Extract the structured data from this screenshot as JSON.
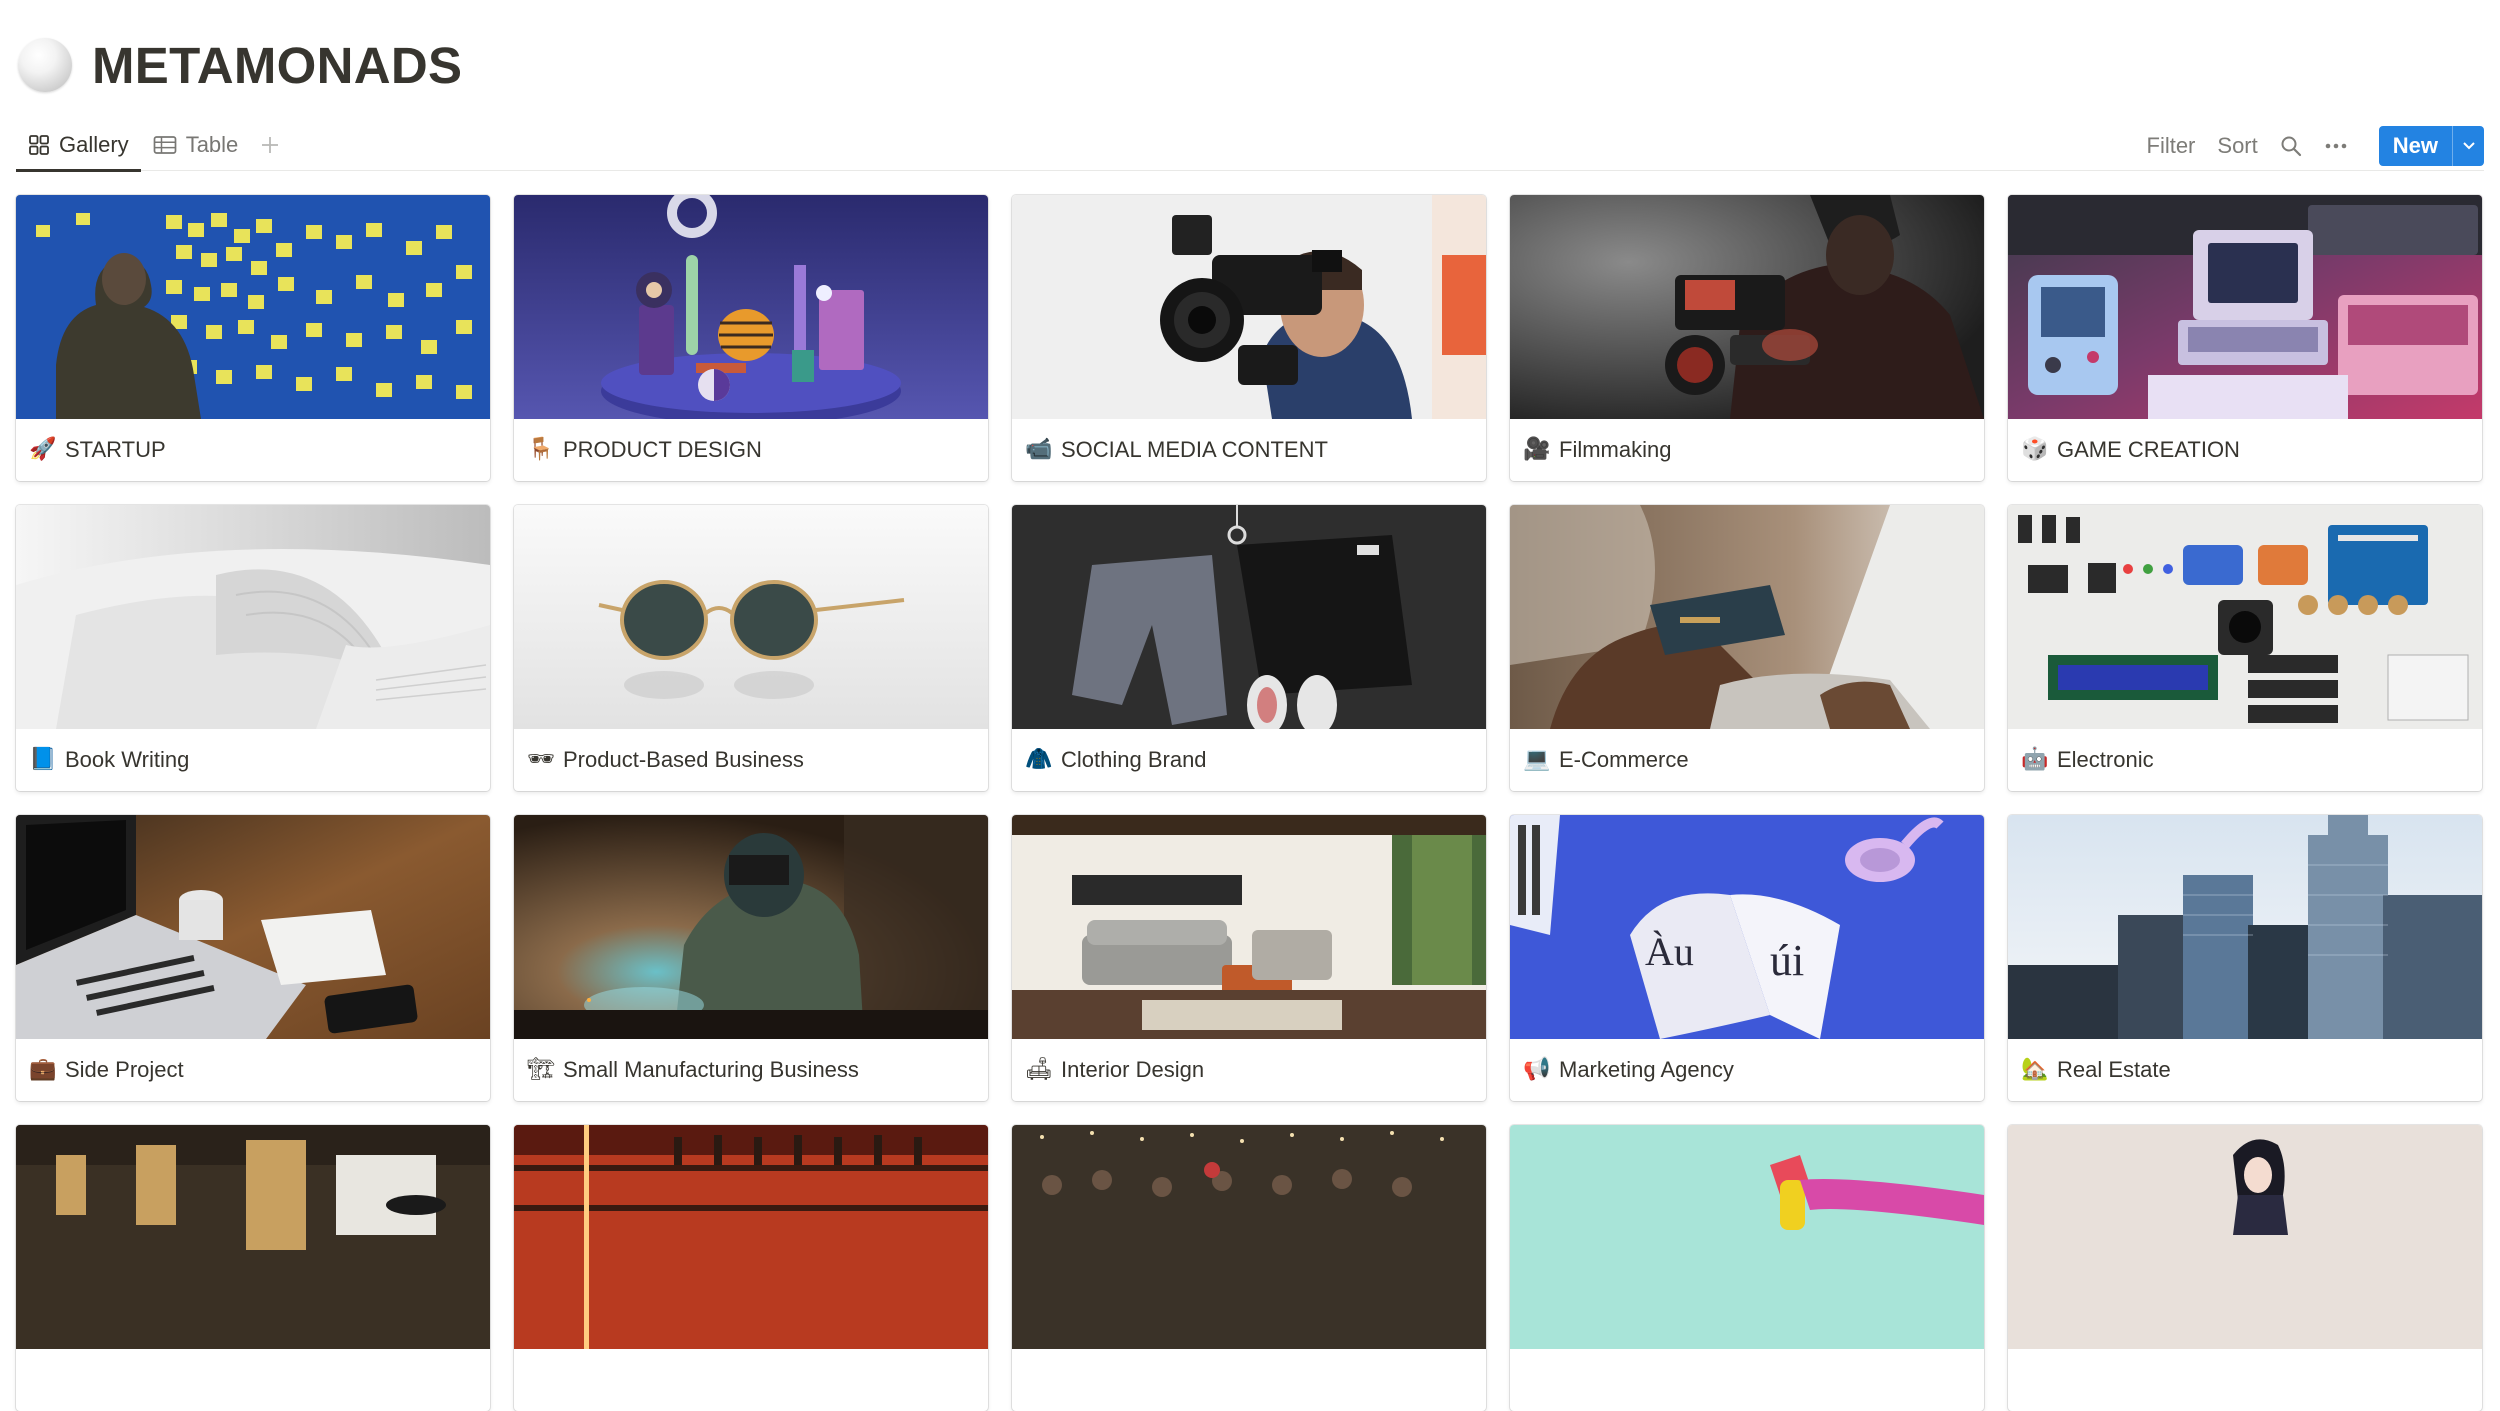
{
  "page": {
    "title": "METAMONADS"
  },
  "views": [
    {
      "label": "Gallery",
      "active": true
    },
    {
      "label": "Table",
      "active": false
    }
  ],
  "toolbar": {
    "filter": "Filter",
    "sort": "Sort",
    "new_label": "New"
  },
  "cards": [
    {
      "icon": "rocket-icon",
      "glyph": "🚀",
      "title": "STARTUP",
      "cover": "sticky-notes-wall"
    },
    {
      "icon": "chair-icon",
      "glyph": "🪑",
      "title": "PRODUCT DESIGN",
      "cover": "3d-objects"
    },
    {
      "icon": "video-camera-icon",
      "glyph": "📹",
      "title": "SOCIAL MEDIA CONTENT",
      "cover": "camera-operator"
    },
    {
      "icon": "movie-camera-icon",
      "glyph": "🎥",
      "title": "Filmmaking",
      "cover": "filmmaker"
    },
    {
      "icon": "die-icon",
      "glyph": "🎲",
      "title": "GAME CREATION",
      "cover": "retro-consoles"
    },
    {
      "icon": "blue-book-icon",
      "glyph": "📘",
      "title": "Book Writing",
      "cover": "open-book"
    },
    {
      "icon": "sunglasses-icon",
      "glyph": "🕶",
      "title": "Product-Based Business",
      "cover": "sunglasses"
    },
    {
      "icon": "coat-icon",
      "glyph": "🧥",
      "title": "Clothing Brand",
      "cover": "clothing-flatlay"
    },
    {
      "icon": "laptop-icon",
      "glyph": "💻",
      "title": "E-Commerce",
      "cover": "credit-card-laptop"
    },
    {
      "icon": "robot-icon",
      "glyph": "🤖",
      "title": "Electronic",
      "cover": "electronic-parts"
    },
    {
      "icon": "briefcase-icon",
      "glyph": "💼",
      "title": "Side Project",
      "cover": "laptop-desk"
    },
    {
      "icon": "factory-icon",
      "glyph": "🏗",
      "title": "Small Manufacturing Business",
      "cover": "welder"
    },
    {
      "icon": "couch-icon",
      "glyph": "🛋",
      "title": "Interior Design",
      "cover": "living-room"
    },
    {
      "icon": "megaphone-icon",
      "glyph": "📢",
      "title": "Marketing Agency",
      "cover": "magazine-blue"
    },
    {
      "icon": "house-icon",
      "glyph": "🏡",
      "title": "Real Estate",
      "cover": "skyscrapers"
    },
    {
      "icon": "",
      "glyph": "",
      "title": "",
      "cover": "restaurant-interior"
    },
    {
      "icon": "",
      "glyph": "",
      "title": "",
      "cover": "bar-shelves"
    },
    {
      "icon": "",
      "glyph": "",
      "title": "",
      "cover": "crowd-event"
    },
    {
      "icon": "",
      "glyph": "",
      "title": "",
      "cover": "cleaning-spray"
    },
    {
      "icon": "",
      "glyph": "",
      "title": "",
      "cover": "anime-figure"
    }
  ]
}
